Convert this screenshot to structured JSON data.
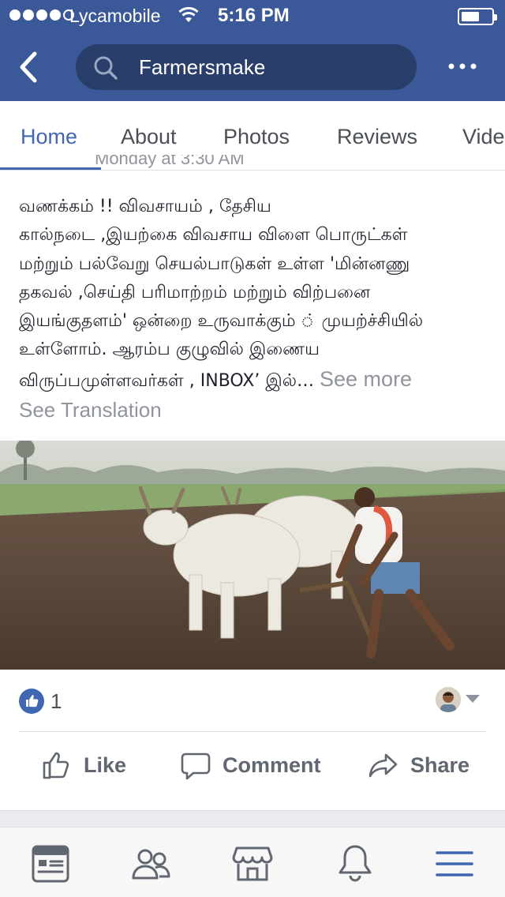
{
  "status_bar": {
    "carrier": "Lycamobile",
    "time": "5:16 PM"
  },
  "header": {
    "search_text": "Farmersmake",
    "back_icon": "chevron-left-icon",
    "more_icon": "ellipsis-icon"
  },
  "tabs": [
    {
      "label": "Home",
      "active": true
    },
    {
      "label": "About",
      "active": false
    },
    {
      "label": "Photos",
      "active": false
    },
    {
      "label": "Reviews",
      "active": false
    },
    {
      "label": "Vide",
      "active": false
    }
  ],
  "post": {
    "meta_partial": "Monday at 3:30 AM",
    "text_lines": [
      "வணக்கம் !! விவசாயம் , தேசிய",
      "கால்நடை ,இயற்கை விவசாய விளை பொருட்கள்",
      "மற்றும் பல்வேறு செயல்பாடுகள் உள்ள 'மின்னணு",
      "தகவல் ,செய்தி பரிமாற்றம் மற்றும் விற்பனை",
      "இயங்குதளம்' ஒன்றை உருவாக்கும் ் முயற்ச்சியில்",
      "உள்ளோம். ஆரம்ப குழுவில் இணைய",
      "விருப்பமுள்ளவர்கள் , INBOX’ இல்… "
    ],
    "see_more": "See more",
    "see_translation": "See Translation",
    "photo_description_icon": "photo-farmer-ploughing-with-oxen"
  },
  "reactions": {
    "like_count": "1"
  },
  "actions": {
    "like": "Like",
    "comment": "Comment",
    "share": "Share"
  },
  "bottom_nav": [
    {
      "icon": "news-feed-icon"
    },
    {
      "icon": "friends-icon"
    },
    {
      "icon": "marketplace-icon"
    },
    {
      "icon": "notifications-bell-icon"
    },
    {
      "icon": "menu-icon",
      "active": true
    }
  ],
  "colors": {
    "brand_blue": "#3b5998",
    "search_bg": "#293e6a",
    "active_blue": "#4267b2",
    "muted_text": "#90949c"
  }
}
